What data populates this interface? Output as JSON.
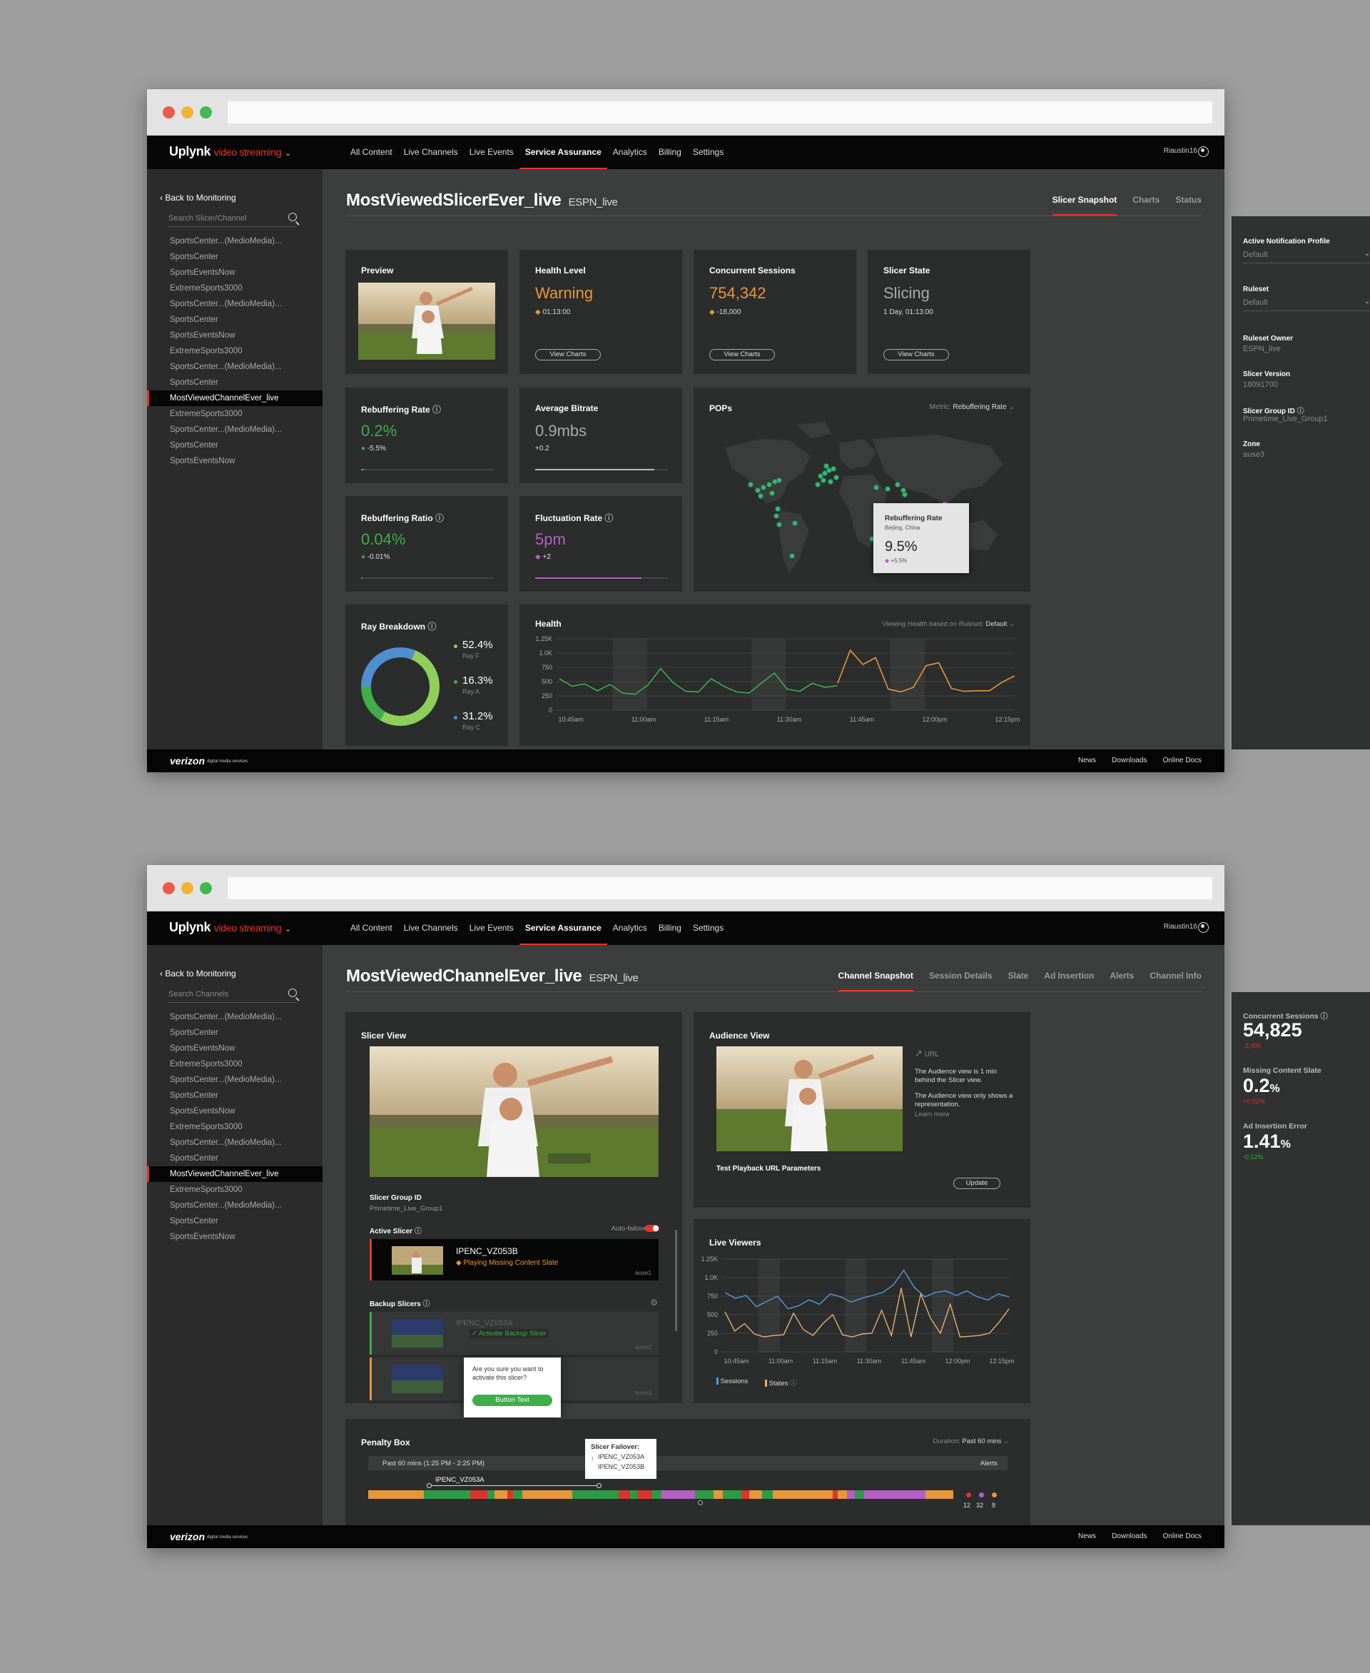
{
  "nav": {
    "logo_main": "Uplynk",
    "logo_sub": "video streaming",
    "items": [
      "All Content",
      "Live Channels",
      "Live Events",
      "Service Assurance",
      "Analytics",
      "Billing",
      "Settings"
    ],
    "active": "Service Assurance",
    "user": "Riaustin16"
  },
  "footer": {
    "brand": "verizon",
    "brand_tag": "digital media services",
    "links": [
      "News",
      "Downloads",
      "Online Docs"
    ]
  },
  "screen1": {
    "back": "Back to Monitoring",
    "search_placeholder": "Search Slicer/Channel",
    "list": [
      "SportsCenter...(MedioMedia)...",
      "SportsCenter",
      "SportsEventsNow",
      "ExtremeSports3000",
      "SportsCenter...(MedioMedia)...",
      "SportsCenter",
      "SportsEventsNow",
      "ExtremeSports3000",
      "SportsCenter...(MedioMedia)...",
      "SportsCenter",
      "MostViewedChannelEver_live",
      "ExtremeSports3000",
      "SportsCenter...(MedioMedia)...",
      "SportsCenter",
      "SportsEventsNow"
    ],
    "selected_index": 10,
    "title": "MostViewedSlicerEver_live",
    "subtitle": "ESPN_live",
    "tabs": [
      "Slicer Snapshot",
      "Charts",
      "Status"
    ],
    "cards": {
      "preview": "Preview",
      "health": {
        "label": "Health Level",
        "value": "Warning",
        "sub": "01:13:00",
        "btn": "View Charts"
      },
      "sessions": {
        "label": "Concurrent Sessions",
        "value": "754,342",
        "sub": "-18,000",
        "btn": "View Charts"
      },
      "state": {
        "label": "Slicer State",
        "value": "Slicing",
        "sub": "1 Day, 01:13:00",
        "btn": "View Charts"
      },
      "rebuf_rate": {
        "label": "Rebuffering Rate",
        "value": "0.2%",
        "sub": "-5.5%",
        "fill": 0.02
      },
      "bitrate": {
        "label": "Average Bitrate",
        "value": "0.9mbs",
        "sub": "+0.2",
        "fill": 0.9
      },
      "rebuf_ratio": {
        "label": "Rebuffering Ratio",
        "value": "0.04%",
        "sub": "-0.01%",
        "fill": 0.01
      },
      "fluct": {
        "label": "Fluctuation Rate",
        "value": "5pm",
        "sub": "+2",
        "fill": 0.8
      },
      "pops": {
        "label": "POPs",
        "metric_label": "Metric:",
        "metric_value": "Rebuffering Rate",
        "tip_title": "Rebuffering Rate",
        "tip_loc": "Beijing, China",
        "tip_value": "9.5%",
        "tip_change": "+5.5%"
      },
      "ray": {
        "label": "Ray Breakdown",
        "items": [
          {
            "pct": "52.4%",
            "name": "Ray F"
          },
          {
            "pct": "16.3%",
            "name": "Ray A"
          },
          {
            "pct": "31.2%",
            "name": "Ray C"
          }
        ]
      },
      "health_chart": {
        "label": "Health",
        "ruleset_label": "Viewing Health based on Ruleset:",
        "ruleset_value": "Default"
      }
    },
    "right": {
      "profile_label": "Active Notification Profile",
      "profile_value": "Default",
      "ruleset_label": "Ruleset",
      "ruleset_value": "Default",
      "owner_label": "Ruleset Owner",
      "owner_value": "ESPN_live",
      "version_label": "Slicer Version",
      "version_value": "18091700",
      "group_label": "Slicer Group ID",
      "group_value": "Primetime_Live_Group1",
      "zone_label": "Zone",
      "zone_value": "ause3"
    }
  },
  "screen2": {
    "back": "Back to Monitoring",
    "search_placeholder": "Search Channels",
    "title": "MostViewedChannelEver_live",
    "subtitle": "ESPN_live",
    "tabs": [
      "Channel Snapshot",
      "Session Details",
      "Slate",
      "Ad Insertion",
      "Alerts",
      "Channel Info"
    ],
    "slicer_view": {
      "label": "Slicer View",
      "group_label": "Slicer Group ID",
      "group_value": "Primetime_Live_Group1",
      "active_label": "Active Slicer",
      "autofailover": "Auto-failover",
      "active_name": "IPENC_VZ053B",
      "active_status": "Playing Missing Content Slate",
      "active_zone": "ause1",
      "backup_label": "Backup Slicers",
      "backup1_name": "IPENC_VZ053A",
      "backup1_action": "Activate Backup Slicer",
      "backup_zone1": "ause2",
      "backup_zone2": "ause3",
      "confirm_text": "Are you sure you want to activate this slicer?",
      "confirm_btn": "Button Text"
    },
    "audience": {
      "label": "Audience View",
      "url": "URL",
      "note1": "The Audience view is 1 min behind the Slicer view.",
      "note2": "The Audience view only shows a representation.",
      "learn": "Learn more",
      "params": "Test Playback URL Parameters",
      "update": "Update"
    },
    "live_viewers": {
      "label": "Live Viewers",
      "legend_sessions": "Sessions",
      "legend_states": "States"
    },
    "penalty": {
      "label": "Penalty Box",
      "duration_label": "Duration:",
      "duration_value": "Past 60 mins",
      "range": "Past 60 mins (1:25 PM - 2:25 PM)",
      "alerts": "Alerts",
      "slicer": "IPENC_VZ053A",
      "fail_title": "Slicer Failover:",
      "fail_a": "IPENC_VZ053A",
      "fail_b": "IPENC_VZ053B",
      "counts": [
        "12",
        "32",
        "8"
      ]
    },
    "metrics": {
      "sessions_label": "Concurrent Sessions",
      "sessions_value": "54,825",
      "sessions_change": "-2,000",
      "slate_label": "Missing Content Slate",
      "slate_value": "0.2",
      "slate_unit": "%",
      "slate_change": "+0.02%",
      "ad_label": "Ad Insertion Error",
      "ad_value": "1.41",
      "ad_unit": "%",
      "ad_change": "-0.12%"
    }
  },
  "chart_data": [
    {
      "type": "line",
      "title": "Health",
      "x": [
        "10:45am",
        "11:00am",
        "11:15am",
        "11:30am",
        "11:45am",
        "12:00pm",
        "12:15pm"
      ],
      "yticks": [
        "1.25K",
        "1.0K",
        "750",
        "500",
        "250",
        "0"
      ],
      "ylim": [
        0,
        1250
      ],
      "series": [
        {
          "name": "",
          "color": "#3fae49",
          "values": [
            550,
            420,
            460,
            340,
            450,
            300,
            280,
            440,
            730,
            480,
            330,
            320,
            550,
            420,
            320,
            300,
            480,
            650,
            370,
            330,
            470,
            400,
            430
          ]
        },
        {
          "name": "",
          "color": "#e8963a",
          "values": [
            470,
            1050,
            800,
            920,
            370,
            320,
            400,
            780,
            830,
            380,
            330,
            340,
            340,
            490,
            600
          ]
        }
      ]
    },
    {
      "type": "line",
      "title": "Live Viewers",
      "x": [
        "10:45am",
        "11:00am",
        "11:15am",
        "11:30am",
        "11:45am",
        "12:00pm",
        "12:15pm"
      ],
      "yticks": [
        "1.25K",
        "1.0K",
        "750",
        "500",
        "250",
        "0"
      ],
      "ylim": [
        0,
        1250
      ],
      "series": [
        {
          "name": "Sessions",
          "color": "#4f9de0",
          "values": [
            800,
            720,
            760,
            610,
            680,
            750,
            580,
            620,
            700,
            640,
            780,
            740,
            670,
            720,
            760,
            800,
            900,
            1100,
            870,
            740,
            800,
            820,
            760,
            820,
            740,
            700,
            780,
            740
          ]
        },
        {
          "name": "States",
          "color": "#e8b072",
          "values": [
            540,
            280,
            380,
            240,
            200,
            220,
            230,
            520,
            300,
            220,
            380,
            500,
            230,
            200,
            240,
            250,
            560,
            220,
            860,
            200,
            780,
            450,
            250,
            640,
            200,
            210,
            220,
            250,
            400,
            580
          ]
        }
      ]
    },
    {
      "type": "pie",
      "title": "Ray Breakdown",
      "categories": [
        "Ray F",
        "Ray A",
        "Ray C"
      ],
      "values": [
        52.4,
        16.3,
        31.2
      ],
      "colors": [
        "#8dcf5a",
        "#3fae49",
        "#4f8fcf"
      ]
    }
  ]
}
